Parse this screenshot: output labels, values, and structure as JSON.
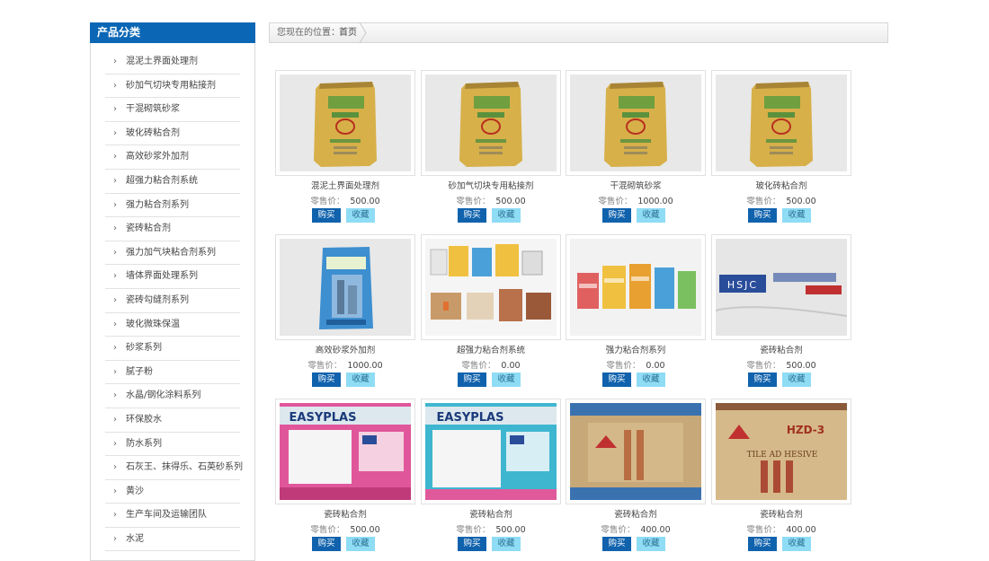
{
  "sidebar": {
    "title": "产品分类",
    "items": [
      {
        "label": "混泥土界面处理剂"
      },
      {
        "label": "砂加气切块专用粘接剂"
      },
      {
        "label": "干混砌筑砂浆"
      },
      {
        "label": "玻化砖粘合剂"
      },
      {
        "label": "高效砂浆外加剂"
      },
      {
        "label": "超强力粘合剂系统"
      },
      {
        "label": "强力粘合剂系列"
      },
      {
        "label": "瓷砖粘合剂"
      },
      {
        "label": "强力加气块粘合剂系列"
      },
      {
        "label": "墙体界面处理系列"
      },
      {
        "label": "瓷砖勾缝剂系列"
      },
      {
        "label": "玻化微珠保温"
      },
      {
        "label": "砂浆系列"
      },
      {
        "label": "腻子粉"
      },
      {
        "label": "水晶/钢化涂料系列"
      },
      {
        "label": "环保胶水"
      },
      {
        "label": "防水系列"
      },
      {
        "label": "石灰王、抹得乐、石英砂系列"
      },
      {
        "label": "黄沙"
      },
      {
        "label": "生产车间及运输团队"
      },
      {
        "label": "水泥"
      }
    ]
  },
  "breadcrumb": {
    "prefix": "您现在的位置：",
    "home": "首页"
  },
  "labels": {
    "price_label": "零售价：",
    "buy": "购买",
    "favorite": "收藏"
  },
  "products": [
    {
      "name": "混泥土界面处理剂",
      "price": "500.00",
      "image": "yellow-bag"
    },
    {
      "name": "砂加气切块专用粘接剂",
      "price": "500.00",
      "image": "yellow-bag"
    },
    {
      "name": "干混砌筑砂浆",
      "price": "1000.00",
      "image": "yellow-bag"
    },
    {
      "name": "玻化砖粘合剂",
      "price": "500.00",
      "image": "yellow-bag"
    },
    {
      "name": "高效砂浆外加剂",
      "price": "1000.00",
      "image": "blue-bag"
    },
    {
      "name": "超强力粘合剂系统",
      "price": "0.00",
      "image": "product-collage"
    },
    {
      "name": "强力粘合剂系列",
      "price": "0.00",
      "image": "bag-row"
    },
    {
      "name": "瓷砖粘合剂",
      "price": "500.00",
      "image": "white-bag-hsjc"
    },
    {
      "name": "瓷砖粘合剂",
      "price": "500.00",
      "image": "easyplas-pink"
    },
    {
      "name": "瓷砖粘合剂",
      "price": "500.00",
      "image": "easyplas-cyan"
    },
    {
      "name": "瓷砖粘合剂",
      "price": "400.00",
      "image": "tan-bag-blue"
    },
    {
      "name": "瓷砖粘合剂",
      "price": "400.00",
      "image": "tan-bag-red"
    }
  ],
  "image_texts": {
    "hsjc": "HSJC",
    "easyplas": "EASYPLAS",
    "hzd": "HZD-3",
    "tile_adhesive": "TILE AD HESIVE"
  }
}
